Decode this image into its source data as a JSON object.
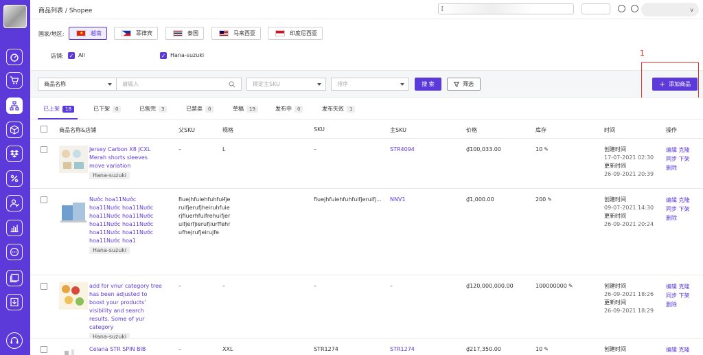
{
  "topbar": {
    "breadcrumb": "商品列表 / Shopee",
    "search_partial": "[",
    "user_partial": "v"
  },
  "filters": {
    "country_label": "国家/地区:",
    "countries": [
      {
        "label": "越南",
        "active": true,
        "flag": "vn"
      },
      {
        "label": "菲律宾",
        "active": false,
        "flag": "ph"
      },
      {
        "label": "泰国",
        "active": false,
        "flag": "th"
      },
      {
        "label": "马来西亚",
        "active": false,
        "flag": "my"
      },
      {
        "label": "印度尼西亚",
        "active": false,
        "flag": "id"
      }
    ],
    "shop_label": "店铺:",
    "shops": [
      {
        "label": "All",
        "checked": true
      },
      {
        "label": "Hana-suzuki",
        "checked": true
      }
    ]
  },
  "annotation": {
    "number": "1"
  },
  "search": {
    "field_select": "商品名称",
    "input_placeholder": "请输入",
    "master_sku_placeholder": "绑定主SKU",
    "sort_placeholder": "排序",
    "search_button": "搜 索",
    "filter_button": "筛选",
    "add_button": "添加商品",
    "add_icon": "plus-icon"
  },
  "tabs": [
    {
      "label": "已上架",
      "count": "18",
      "active": true
    },
    {
      "label": "已下架",
      "count": "0"
    },
    {
      "label": "已售完",
      "count": "3"
    },
    {
      "label": "已禁卖",
      "count": "0"
    },
    {
      "label": "草稿",
      "count": "19"
    },
    {
      "label": "发布中",
      "count": "0"
    },
    {
      "label": "发布失败",
      "count": "1"
    }
  ],
  "columns": {
    "name": "商品名称&店铺",
    "parent_sku": "父SKU",
    "spec": "规格",
    "sku": "SKU",
    "master_sku": "主SKU",
    "price": "价格",
    "stock": "库存",
    "time": "时间",
    "actions": "操作"
  },
  "time_labels": {
    "created": "创建时间",
    "updated": "更新时间"
  },
  "action_labels": {
    "edit": "编辑",
    "clone": "克隆",
    "sync": "同步",
    "delist": "下架",
    "delete": "删除"
  },
  "rows": [
    {
      "name": "Jersey Carbon X8 JCXL Merah shorts sleeves move variation",
      "shop": "Hana-suzuki",
      "parent_sku": "–",
      "spec": "L",
      "sku": "–",
      "master_sku": "STR4094",
      "price": "₫100,033.00",
      "stock": "10",
      "created": "17-07-2021 02:30",
      "updated": "26-09-2021 20:39"
    },
    {
      "name": "Nước hoa11Nước hoa11Nước hoa11Nước hoa11Nước hoa11Nước hoa11Nước hoa11Nước hoa11Nước hoa11Nước hoa11Nước hoa1",
      "shop": "Hana-suzuki",
      "parent_sku": "fiuejhfuiehfuhfuifjeruifjerufjheiruhfuierjfiuerhfuifrehuifjeruifjerfjierufjiurffehrufhejrufjeirujfe",
      "spec": "–",
      "sku": "fiuejhfuiehfuhfuifjeruifj...",
      "master_sku": "NNV1",
      "price": "₫1,000.00",
      "stock": "200",
      "created": "09-07-2021 14:30",
      "updated": "26-09-2021 20:24"
    },
    {
      "name": "add for vnur category tree has been adjusted to boost your products' visibility and search results. Some of yur category",
      "shop": "Hana-suzuki",
      "parent_sku": "–",
      "spec": "–",
      "sku": "–",
      "master_sku": "–",
      "price": "₫120,000,000.00",
      "stock": "100000000",
      "created": "26-09-2021 18:26",
      "updated": "26-09-2021 18:29"
    },
    {
      "name": "Celana STR SPIN BIB",
      "shop": "",
      "parent_sku": "–",
      "spec": "XXL",
      "sku": "STR1274",
      "master_sku": "STR1274",
      "price": "₫217,350.00",
      "stock": "10",
      "created": "",
      "updated": ""
    }
  ]
}
